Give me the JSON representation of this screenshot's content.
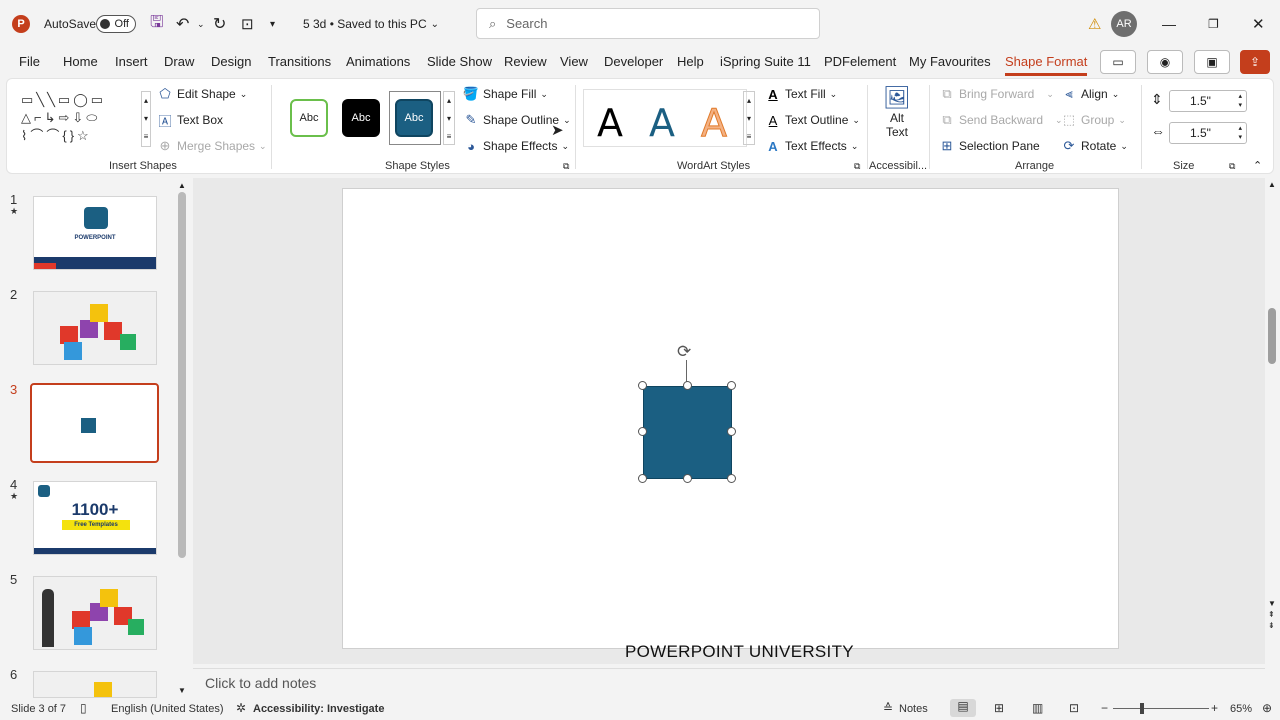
{
  "titlebar": {
    "app_icon": "powerpoint-icon",
    "autosave_label": "AutoSave",
    "autosave_state": "Off",
    "file_title": "5 3d • Saved to this PC",
    "search_placeholder": "Search",
    "avatar_initials": "AR"
  },
  "tabs": [
    "File",
    "Home",
    "Insert",
    "Draw",
    "Design",
    "Transitions",
    "Animations",
    "Slide Show",
    "Review",
    "View",
    "Developer",
    "Help",
    "iSpring Suite 11",
    "PDFelement",
    "My Favourites",
    "Shape Format"
  ],
  "ribbon": {
    "insert_shapes": {
      "edit_shape": "Edit Shape",
      "text_box": "Text Box",
      "merge_shapes": "Merge Shapes",
      "label": "Insert Shapes"
    },
    "shape_styles": {
      "presets": [
        "Abc",
        "Abc",
        "Abc"
      ],
      "shape_fill": "Shape Fill",
      "shape_outline": "Shape Outline",
      "shape_effects": "Shape Effects",
      "label": "Shape Styles"
    },
    "wordart": {
      "letters": [
        "A",
        "A",
        "A"
      ],
      "text_fill": "Text Fill",
      "text_outline": "Text Outline",
      "text_effects": "Text Effects",
      "label": "WordArt Styles"
    },
    "accessibility": {
      "alt_text_1": "Alt",
      "alt_text_2": "Text",
      "label": "Accessibil..."
    },
    "arrange": {
      "bring_forward": "Bring Forward",
      "send_backward": "Send Backward",
      "selection_pane": "Selection Pane",
      "align": "Align",
      "group": "Group",
      "rotate": "Rotate",
      "label": "Arrange"
    },
    "size": {
      "height": "1.5\"",
      "width": "1.5\"",
      "label": "Size"
    }
  },
  "slides": [
    {
      "num": "1",
      "star": "★"
    },
    {
      "num": "2",
      "star": ""
    },
    {
      "num": "3",
      "star": ""
    },
    {
      "num": "4",
      "star": "★"
    },
    {
      "num": "5",
      "star": ""
    },
    {
      "num": "6",
      "star": ""
    }
  ],
  "thumb_text": {
    "powerpoint": "POWERPOINT",
    "templates_count": "1100+",
    "templates_label": "Free Templates"
  },
  "slide": {
    "footer": "POWERPOINT UNIVERSITY",
    "shape_color": "#1b5f82"
  },
  "notes_placeholder": "Click to add notes",
  "status": {
    "slide_count": "Slide 3 of 7",
    "language": "English (United States)",
    "accessibility": "Accessibility: Investigate",
    "notes": "Notes",
    "zoom": "65%"
  },
  "colors": {
    "accent": "#c43e1c",
    "shape": "#1b5f82"
  }
}
